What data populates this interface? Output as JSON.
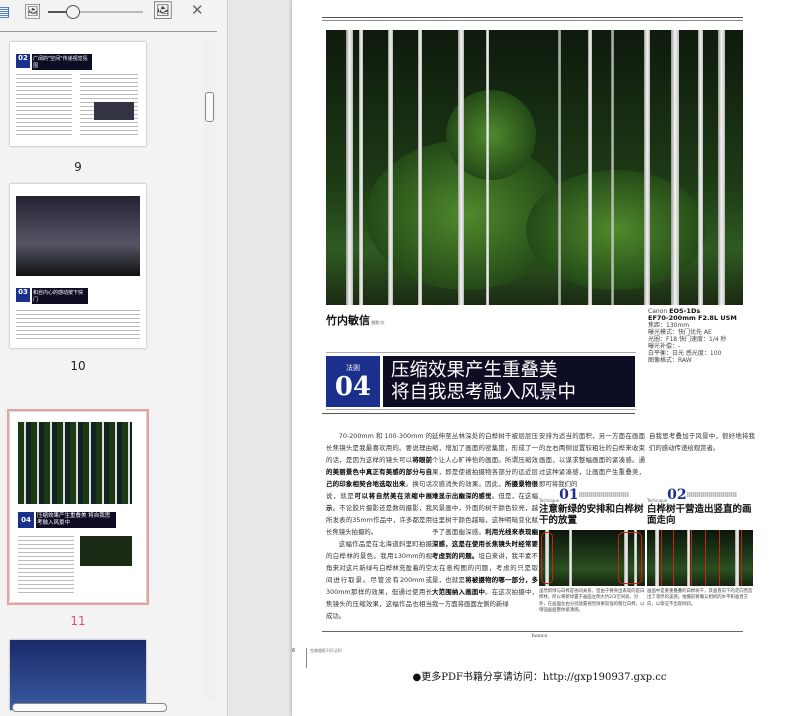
{
  "toolbar": {
    "zoom_level_fraction": 0.25
  },
  "thumbnails": [
    {
      "label": "9",
      "title": "广阔的\"空间\"传递视觉氛围",
      "rule": "02"
    },
    {
      "label": "10",
      "title": "和自内心的感动按下快门",
      "rule": "03"
    },
    {
      "label": "11",
      "title": "压缩效果产生重叠美 将自我思考融入风景中",
      "rule": "04",
      "selected": true
    }
  ],
  "page": {
    "author": "竹内敏信",
    "author_role": "·摄影/文",
    "camera": {
      "body_brand": "Canon",
      "body": "EOS-1Ds",
      "lens": "EF70-200mm F2.8L USM",
      "lines": [
        "焦距：130mm",
        "曝光模式：快门优先 AE",
        "光圈：F18 快门速度：1/4 秒",
        "曝光补偿：-",
        "白平衡：日光 感光度：100",
        "图像格式：RAW"
      ]
    },
    "rule_label": "法则",
    "rule_number": "04",
    "title_line1": "压缩效果产生重叠美",
    "title_line2": "将自我思考融入风景中",
    "col1": [
      "70-200mm和100-300mm的长焦镜头是我最喜欢用的。要说理由的话，是因为这样的镜头可以",
      "将眼前的美丽景色中真正有美感的部分与自己的印象相契合地选取出来",
      "。换句话说，就是",
      "可以将自然美在浓缩中展示",
      "。不论胶片摄影还是数码摄影，我所发表的35mm作品中，许多都是用长焦镜头拍摄的。",
      "这幅作品是在北海道斜里町拍摄的白桦林的景色。我用130mm的视角来对这片新绿与白桦林充盈着的空间进行取景。尽管没有200mm或300mm那样的效果，但通过使用长焦镜头的压缩效果，这幅作品也相当成功。"
    ],
    "col2": [
      "延伸至丛林深处的白桦树干被层层压缩，增加了画面的密集度，形成了一个让人心旷神怡的画面。所谓压缩效果，即是使被拍摄物各部分的远近层次感消失的效果。因此，",
      "所摄景物很难显示出幽深的感觉",
      "。但是，在这幅风景画中，外面的树干颜色较亮，越往里树干颜色越暗，这种明暗变化赋予了画面幽深感。",
      "利用光线来表现幽深感，这是在使用长焦镜头时经常要考虑到的问题。",
      "坦白来讲，我平素不太在意构图的问题，考虑的只是取景，也就是",
      "将被摄物的哪一部分，多大范围纳入画面中",
      "。在这次拍摄中，我一方面将画面左侧的新绿"
    ],
    "col3": "安排为适当的面积，另一方面在画面的左右两侧设置较粗壮的白桦来收束画面，以谋求整幅画面的紧凑感。通过这种紧凑感，让画面产生重叠美，即可将我们的",
    "col4": "自我思考叠加于风景中，很好地将我们的感动传递给观赏者。",
    "techniques": [
      {
        "label": "Technique",
        "number": "01",
        "heading": "注意新绿的安排和白桦树干的放置",
        "caption": "虽然新绿与白桦是协同关系，但由于要突出表现的是白桦林，所以将新绿置于画面左侧大约2/3空间处。另外，在画面左右分别放置视觉效果较强的粗壮白桦，以增强画面整体紧凑感。"
      },
      {
        "label": "Technique",
        "number": "02",
        "heading": "白桦树干营造出竖直的画面走向",
        "caption": "画面中是重重叠叠的白桦树干，其垂直向下的走向营造出了凛然的美感。拍摄前要确认相机的水平和垂直方向，以保证不出现倾斜。"
      }
    ],
    "footer_section": "basics",
    "footer_page": "6",
    "footer_book": "完美摄影165法则",
    "share_text": "●更多PDF书籍分享请访问：http://gxp190937.gxp.cc"
  }
}
